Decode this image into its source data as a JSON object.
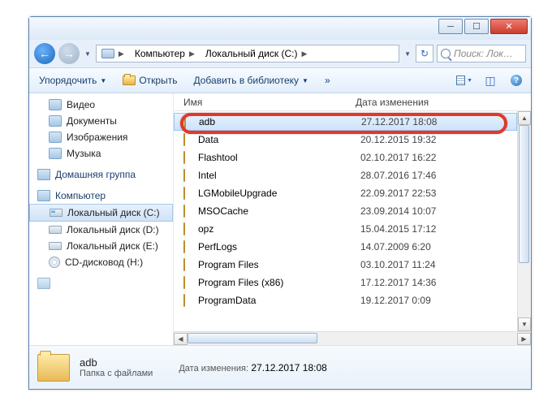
{
  "breadcrumb": {
    "seg1": "Компьютер",
    "seg2": "Локальный диск (C:)"
  },
  "search": {
    "placeholder": "Поиск: Лок…"
  },
  "toolbar": {
    "organize": "Упорядочить",
    "open": "Открыть",
    "addlib": "Добавить в библиотеку",
    "more": "»"
  },
  "sidebar": {
    "libs": [
      "Видео",
      "Документы",
      "Изображения",
      "Музыка"
    ],
    "homegroup": "Домашняя группа",
    "computer": "Компьютер",
    "drives": [
      "Локальный диск (C:)",
      "Локальный диск (D:)",
      "Локальный диск (E:)",
      "CD-дисковод (H:)"
    ]
  },
  "columns": {
    "name": "Имя",
    "modified": "Дата изменения"
  },
  "files": [
    {
      "name": "adb",
      "date": "27.12.2017 18:08",
      "selected": true
    },
    {
      "name": "Data",
      "date": "20.12.2015 19:32"
    },
    {
      "name": "Flashtool",
      "date": "02.10.2017 16:22"
    },
    {
      "name": "Intel",
      "date": "28.07.2016 17:46"
    },
    {
      "name": "LGMobileUpgrade",
      "date": "22.09.2017 22:53"
    },
    {
      "name": "MSOCache",
      "date": "23.09.2014 10:07"
    },
    {
      "name": "opz",
      "date": "15.04.2015 17:12"
    },
    {
      "name": "PerfLogs",
      "date": "14.07.2009 6:20"
    },
    {
      "name": "Program Files",
      "date": "03.10.2017 11:24"
    },
    {
      "name": "Program Files (x86)",
      "date": "17.12.2017 14:36"
    },
    {
      "name": "ProgramData",
      "date": "19.12.2017 0:09"
    }
  ],
  "details": {
    "name": "adb",
    "type": "Папка с файлами",
    "modlabel": "Дата изменения:",
    "modval": "27.12.2017 18:08"
  }
}
